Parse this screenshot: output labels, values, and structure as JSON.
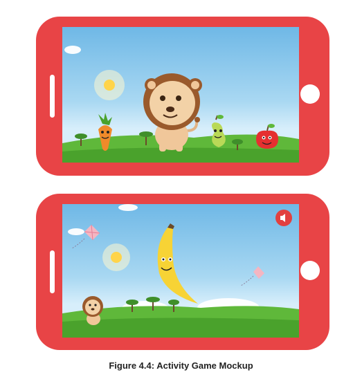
{
  "caption": "Figure  4.4: Activity Game Mockup",
  "colors": {
    "phone_body": "#e84446",
    "sky_top": "#6fb8e6",
    "grass": "#5fb83a",
    "screen_button": "#ffffff"
  },
  "screens": [
    {
      "id": "screen-1",
      "characters": [
        "lion",
        "carrot",
        "pear",
        "apple"
      ],
      "decor": [
        "sun",
        "trees",
        "bushes",
        "clouds"
      ]
    },
    {
      "id": "screen-2",
      "characters": [
        "banana",
        "lion"
      ],
      "decor": [
        "sun",
        "kite",
        "kite",
        "trees",
        "bushes",
        "clouds"
      ],
      "controls": [
        "sound-icon"
      ]
    }
  ]
}
